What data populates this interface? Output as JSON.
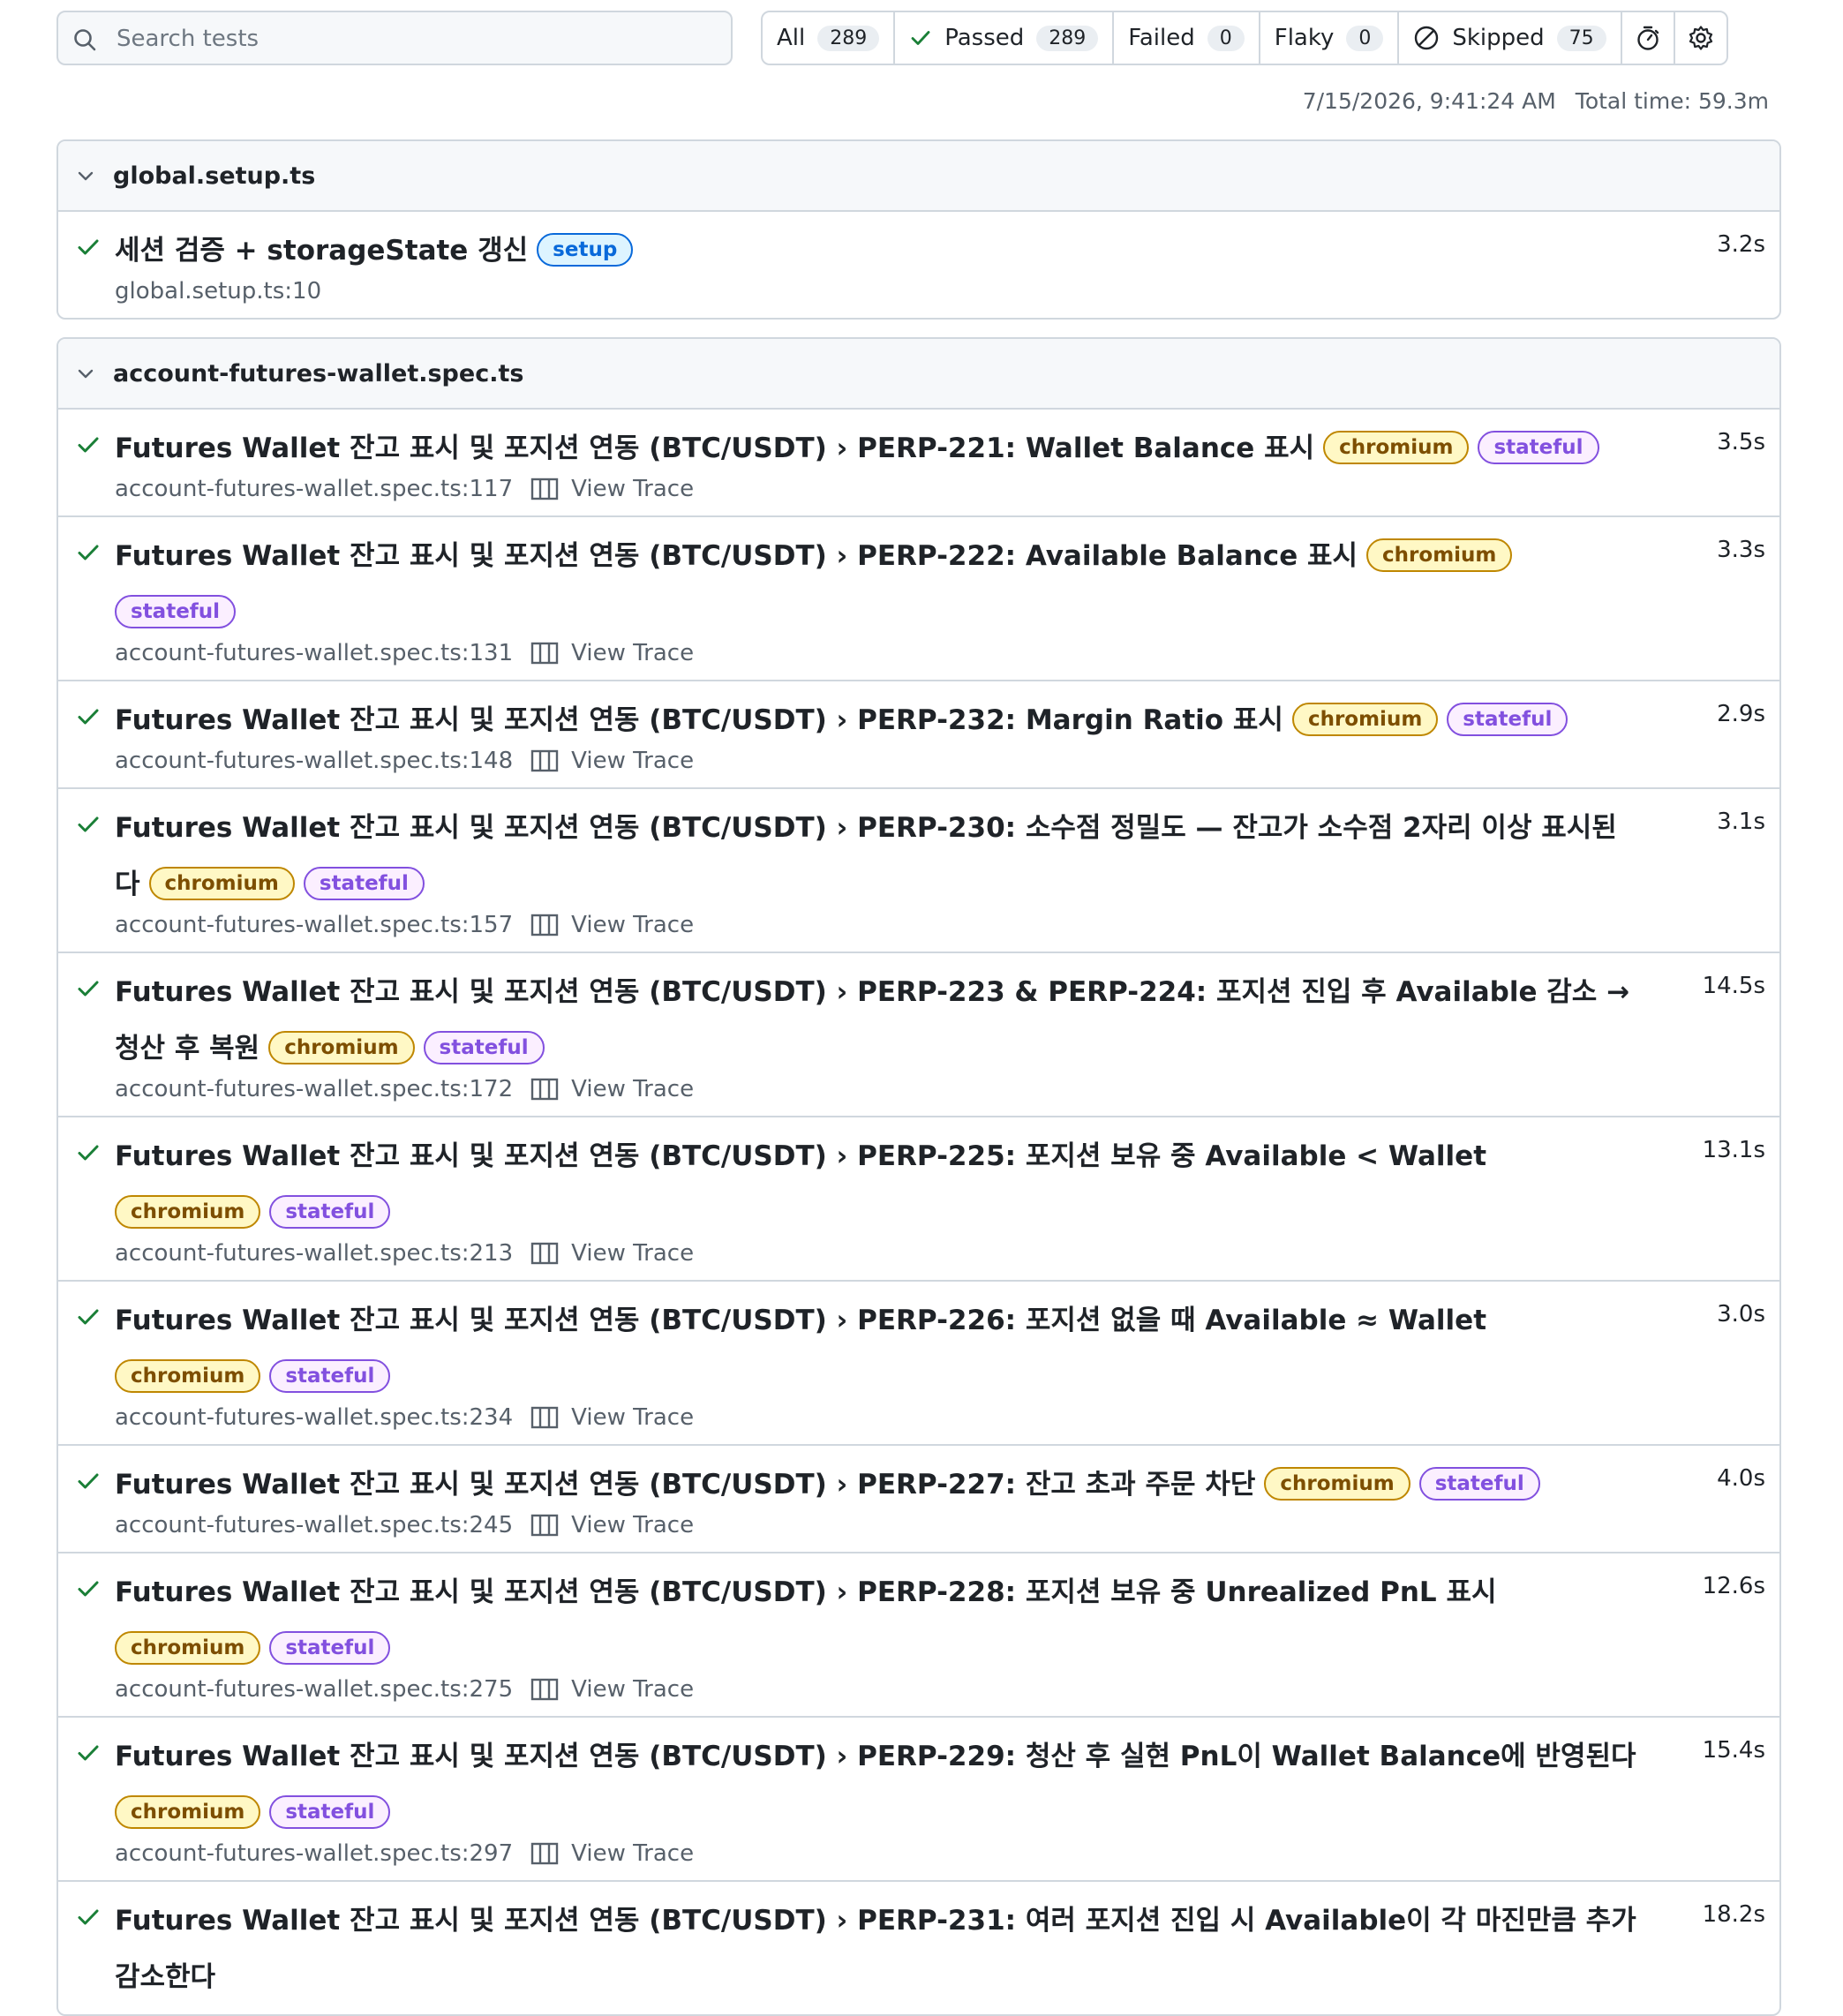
{
  "search": {
    "placeholder": "Search tests",
    "value": ""
  },
  "filters": {
    "all": {
      "label": "All",
      "count": "289"
    },
    "passed": {
      "label": "Passed",
      "count": "289"
    },
    "failed": {
      "label": "Failed",
      "count": "0"
    },
    "flaky": {
      "label": "Flaky",
      "count": "0"
    },
    "skipped": {
      "label": "Skipped",
      "count": "75"
    }
  },
  "run": {
    "datetime": "7/15/2026, 9:41:24 AM",
    "total_time": "Total time: 59.3m"
  },
  "colors": {
    "pass": "#1a7f37",
    "chromium": "#bf8700",
    "stateful": "#8250df",
    "setup": "#0969da"
  },
  "files": [
    {
      "name": "global.setup.ts",
      "tests": [
        {
          "title": "세션 검증 + storageState 갱신",
          "badges": [
            "setup"
          ],
          "location": "global.setup.ts:10",
          "duration": "3.2s"
        }
      ]
    },
    {
      "name": "account-futures-wallet.spec.ts",
      "trace_label": "View Trace",
      "tests": [
        {
          "title": "Futures Wallet 잔고 표시 및 포지션 연동 (BTC/USDT) › PERP-221: Wallet Balance 표시",
          "badges": [
            "chromium",
            "stateful"
          ],
          "location": "account-futures-wallet.spec.ts:117",
          "duration": "3.5s"
        },
        {
          "title": "Futures Wallet 잔고 표시 및 포지션 연동 (BTC/USDT) › PERP-222: Available Balance 표시",
          "badges": [
            "chromium",
            "stateful"
          ],
          "location": "account-futures-wallet.spec.ts:131",
          "duration": "3.3s"
        },
        {
          "title": "Futures Wallet 잔고 표시 및 포지션 연동 (BTC/USDT) › PERP-232: Margin Ratio 표시",
          "badges": [
            "chromium",
            "stateful"
          ],
          "location": "account-futures-wallet.spec.ts:148",
          "duration": "2.9s"
        },
        {
          "title": "Futures Wallet 잔고 표시 및 포지션 연동 (BTC/USDT) › PERP-230: 소수점 정밀도 — 잔고가 소수점 2자리 이상 표시된다",
          "badges": [
            "chromium",
            "stateful"
          ],
          "location": "account-futures-wallet.spec.ts:157",
          "duration": "3.1s"
        },
        {
          "title": "Futures Wallet 잔고 표시 및 포지션 연동 (BTC/USDT) › PERP-223 & PERP-224: 포지션 진입 후 Available 감소 → 청산 후 복원",
          "badges": [
            "chromium",
            "stateful"
          ],
          "location": "account-futures-wallet.spec.ts:172",
          "duration": "14.5s"
        },
        {
          "title": "Futures Wallet 잔고 표시 및 포지션 연동 (BTC/USDT) › PERP-225: 포지션 보유 중 Available < Wallet",
          "badges": [
            "chromium",
            "stateful"
          ],
          "location": "account-futures-wallet.spec.ts:213",
          "duration": "13.1s"
        },
        {
          "title": "Futures Wallet 잔고 표시 및 포지션 연동 (BTC/USDT) › PERP-226: 포지션 없을 때 Available ≈ Wallet",
          "badges": [
            "chromium",
            "stateful"
          ],
          "location": "account-futures-wallet.spec.ts:234",
          "duration": "3.0s"
        },
        {
          "title": "Futures Wallet 잔고 표시 및 포지션 연동 (BTC/USDT) › PERP-227: 잔고 초과 주문 차단",
          "badges": [
            "chromium",
            "stateful"
          ],
          "location": "account-futures-wallet.spec.ts:245",
          "duration": "4.0s"
        },
        {
          "title": "Futures Wallet 잔고 표시 및 포지션 연동 (BTC/USDT) › PERP-228: 포지션 보유 중 Unrealized PnL 표시",
          "badges": [
            "chromium",
            "stateful"
          ],
          "location": "account-futures-wallet.spec.ts:275",
          "duration": "12.6s"
        },
        {
          "title": "Futures Wallet 잔고 표시 및 포지션 연동 (BTC/USDT) › PERP-229: 청산 후 실현 PnL이 Wallet Balance에 반영된다",
          "badges": [
            "chromium",
            "stateful"
          ],
          "location": "account-futures-wallet.spec.ts:297",
          "duration": "15.4s"
        },
        {
          "title": "Futures Wallet 잔고 표시 및 포지션 연동 (BTC/USDT) › PERP-231: 여러 포지션 진입 시 Available이 각 마진만큼 추가 감소한다",
          "badges": [],
          "location": "",
          "duration": "18.2s"
        }
      ]
    }
  ]
}
